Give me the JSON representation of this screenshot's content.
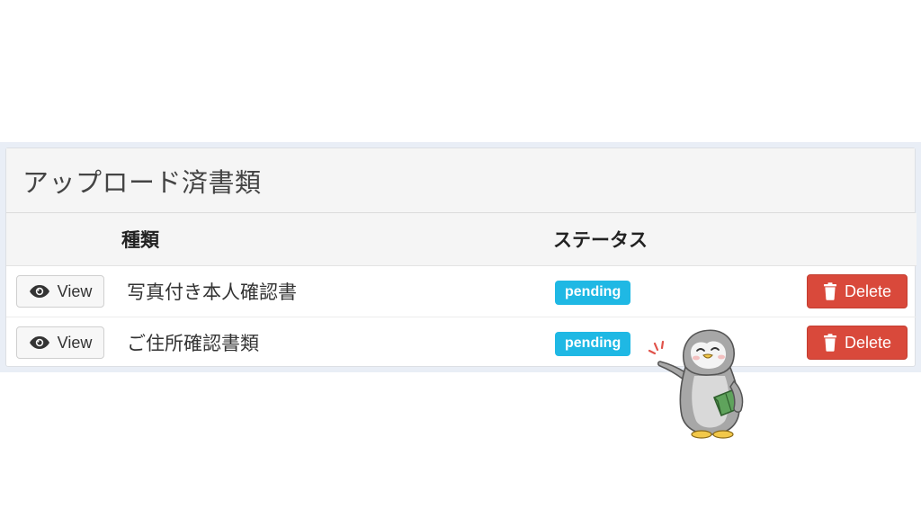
{
  "panel": {
    "title": "アップロード済書類"
  },
  "table": {
    "headers": {
      "view": "",
      "type": "種類",
      "status": "ステータス",
      "actions": ""
    },
    "rows": [
      {
        "view_label": "View",
        "type": "写真付き本人確認書",
        "status": "pending",
        "delete_label": "Delete"
      },
      {
        "view_label": "View",
        "type": "ご住所確認書類",
        "status": "pending",
        "delete_label": "Delete"
      }
    ]
  },
  "icons": {
    "view": "eye-icon",
    "delete": "trash-icon"
  },
  "colors": {
    "status_badge": "#1fb8e4",
    "delete_button": "#d9493b",
    "panel_heading_bg": "#f5f5f5"
  }
}
